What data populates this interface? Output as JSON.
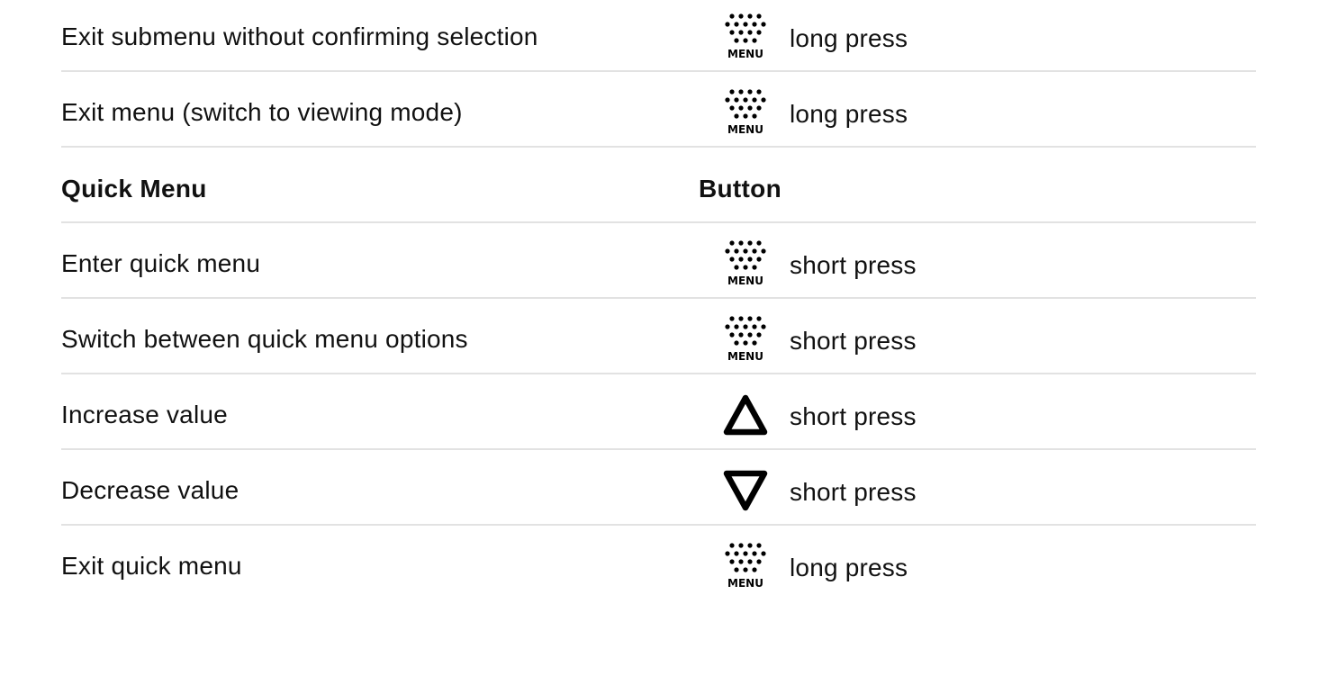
{
  "rows": [
    {
      "kind": "item",
      "action": "Exit submenu without confirming selection",
      "icon": "menu-button-icon",
      "icon_label": "MENU",
      "press": "long press"
    },
    {
      "kind": "item",
      "action": "Exit menu (switch to viewing mode)",
      "icon": "menu-button-icon",
      "icon_label": "MENU",
      "press": "long press"
    },
    {
      "kind": "header",
      "col1": "Quick Menu",
      "col2": "Button"
    },
    {
      "kind": "item",
      "action": "Enter quick menu",
      "icon": "menu-button-icon",
      "icon_label": "MENU",
      "press": "short press"
    },
    {
      "kind": "item",
      "action": "Switch between quick menu options",
      "icon": "menu-button-icon",
      "icon_label": "MENU",
      "press": "short press"
    },
    {
      "kind": "item",
      "action": "Increase value",
      "icon": "up-triangle-icon",
      "press": "short press"
    },
    {
      "kind": "item",
      "action": "Decrease value",
      "icon": "down-triangle-icon",
      "press": "short press"
    },
    {
      "kind": "item",
      "action": "Exit quick menu",
      "icon": "menu-button-icon",
      "icon_label": "MENU",
      "press": "long press"
    }
  ]
}
